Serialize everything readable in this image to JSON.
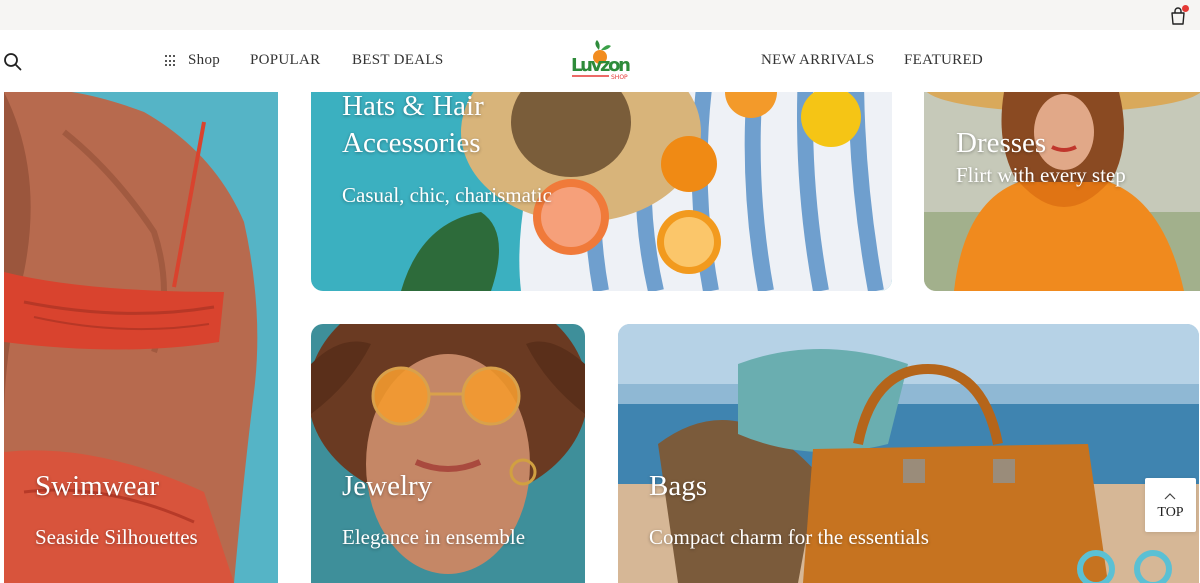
{
  "header": {
    "cart_icon": "shopping-bag-icon",
    "search_icon": "search-icon",
    "nav": {
      "shop": "Shop",
      "popular": "POPULAR",
      "best_deals": "BEST DEALS",
      "new_arrivals": "NEW ARRIVALS",
      "featured": "FEATURED"
    },
    "logo": {
      "word": "Luvzon",
      "tag": "SHOP"
    }
  },
  "tiles": {
    "swimwear": {
      "title": "Swimwear",
      "subtitle": "Seaside Silhouettes"
    },
    "hats": {
      "title": "Hats & Hair Accessories",
      "subtitle": "Casual, chic, charismatic"
    },
    "dresses": {
      "title": "Dresses",
      "subtitle": "Flirt with every step"
    },
    "jewelry": {
      "title": "Jewelry",
      "subtitle": "Elegance in ensemble"
    },
    "bags": {
      "title": "Bags",
      "subtitle": "Compact charm for the essentials"
    }
  },
  "back_to_top": {
    "label": "TOP"
  },
  "colors": {
    "accent_red": "#e53935",
    "logo_green": "#2e8b3a",
    "logo_orange": "#f28c1f"
  }
}
